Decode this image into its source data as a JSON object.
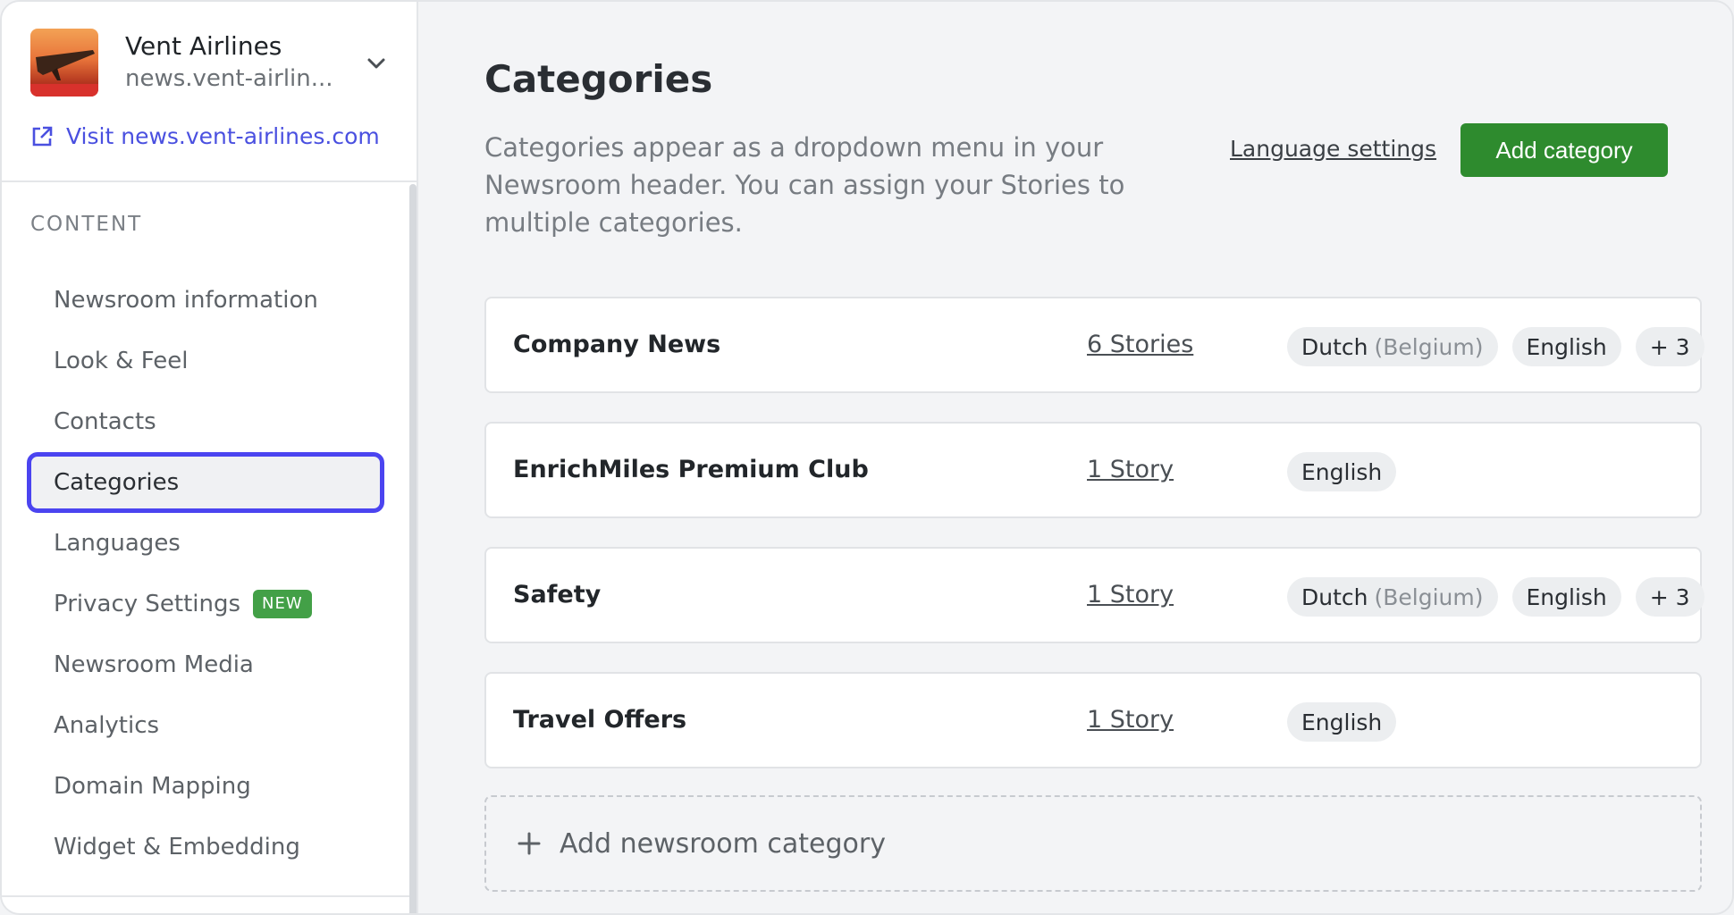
{
  "sidebar": {
    "brand_name": "Vent Airlines",
    "brand_domain": "news.vent-airlin...",
    "visit_link": "Visit news.vent-airlines.com",
    "section_title": "CONTENT",
    "items": [
      {
        "label": "Newsroom information"
      },
      {
        "label": "Look & Feel"
      },
      {
        "label": "Contacts"
      },
      {
        "label": "Categories",
        "active": true
      },
      {
        "label": "Languages"
      },
      {
        "label": "Privacy Settings",
        "badge": "NEW"
      },
      {
        "label": "Newsroom Media"
      },
      {
        "label": "Analytics"
      },
      {
        "label": "Domain Mapping"
      },
      {
        "label": "Widget & Embedding"
      }
    ]
  },
  "main": {
    "title": "Categories",
    "description": "Categories appear as a dropdown menu in your Newsroom header. You can assign your Stories to multiple categories.",
    "language_settings_label": "Language settings",
    "add_category_label": "Add category",
    "categories": [
      {
        "name": "Company News",
        "stories": "6 Stories",
        "languages": [
          {
            "main": "Dutch",
            "sub": "(Belgium)"
          },
          {
            "main": "English"
          },
          {
            "main": "+ 3"
          }
        ]
      },
      {
        "name": "EnrichMiles Premium Club",
        "stories": "1 Story",
        "languages": [
          {
            "main": "English"
          }
        ]
      },
      {
        "name": "Safety",
        "stories": "1 Story",
        "languages": [
          {
            "main": "Dutch",
            "sub": "(Belgium)"
          },
          {
            "main": "English"
          },
          {
            "main": "+ 3"
          }
        ]
      },
      {
        "name": "Travel Offers",
        "stories": "1 Story",
        "languages": [
          {
            "main": "English"
          }
        ]
      }
    ],
    "add_newsroom_category_label": "Add newsroom category"
  },
  "colors": {
    "accent_primary": "#2e8b2e",
    "link": "#4a50e0",
    "active_outline": "#4b44f0",
    "badge_new": "#43a047"
  },
  "icons": {
    "brand_chevron": "chevron-down-icon",
    "visit": "external-link-icon",
    "add": "plus-icon"
  }
}
